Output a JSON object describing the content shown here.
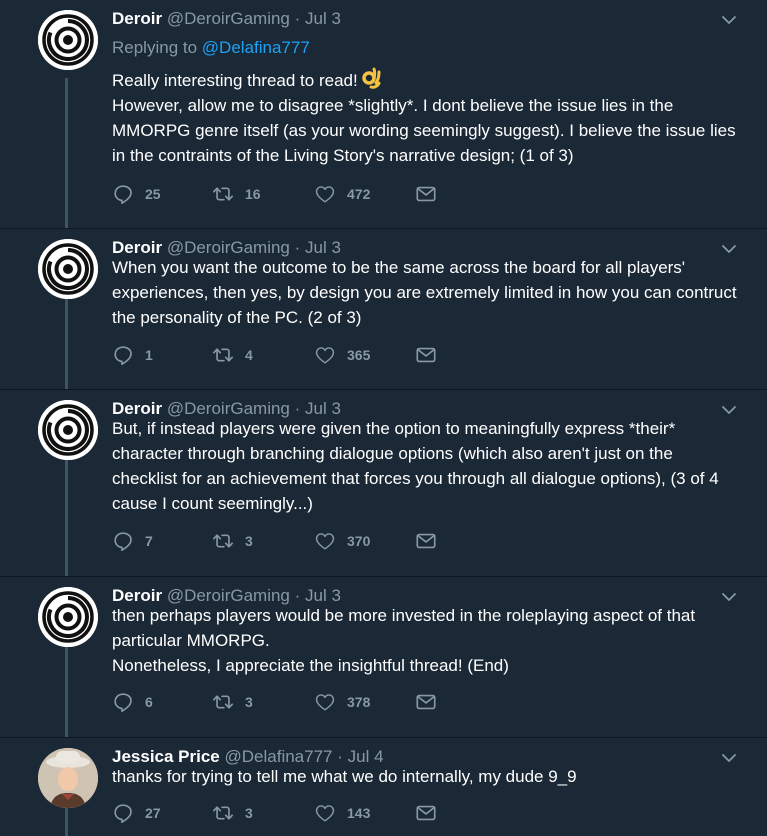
{
  "colors": {
    "background": "#1b2836",
    "text": "#ffffff",
    "muted": "#8899a6",
    "link": "#1da1f2",
    "thread_line": "#3d5466"
  },
  "tweets": [
    {
      "name": "Deroir",
      "handle": "@DeroirGaming",
      "dot": "·",
      "date": "Jul 3",
      "reply_prefix": "Replying to",
      "reply_mention": "@Delafina777",
      "lines": [
        "Really interesting thread to read!",
        "However, allow me to disagree *slightly*. I dont believe the issue lies in the MMORPG genre itself (as your wording seemingly suggest). I believe the issue lies in the contraints of the Living Story's narrative design; (1 of 3)"
      ],
      "emoji": "ok-hand-emoji",
      "replies": "25",
      "retweets": "16",
      "likes": "472"
    },
    {
      "name": "Deroir",
      "handle": "@DeroirGaming",
      "dot": "·",
      "date": "Jul 3",
      "lines": [
        "When you want the outcome to be the same across the board for all players' experiences, then yes, by design you are extremely limited in how you can contruct the personality of the PC. (2 of 3)"
      ],
      "replies": "1",
      "retweets": "4",
      "likes": "365"
    },
    {
      "name": "Deroir",
      "handle": "@DeroirGaming",
      "dot": "·",
      "date": "Jul 3",
      "lines": [
        "But, if instead players were given the option to meaningfully express *their* character through branching dialogue options (which also aren't just on the checklist for an achievement that forces you through all dialogue options), (3 of 4 cause I count seemingly...)"
      ],
      "replies": "7",
      "retweets": "3",
      "likes": "370"
    },
    {
      "name": "Deroir",
      "handle": "@DeroirGaming",
      "dot": "·",
      "date": "Jul 3",
      "lines": [
        "then perhaps players would be more invested in the roleplaying aspect of that particular MMORPG.",
        "Nonetheless, I appreciate the insightful thread! (End)"
      ],
      "replies": "6",
      "retweets": "3",
      "likes": "378"
    },
    {
      "name": "Jessica Price",
      "handle": "@Delafina777",
      "dot": "·",
      "date": "Jul 4",
      "lines": [
        "thanks for trying to tell me what we do internally, my dude 9_9"
      ],
      "replies": "27",
      "retweets": "3",
      "likes": "143"
    }
  ],
  "icons": [
    "reply-icon",
    "retweet-icon",
    "like-icon",
    "message-icon",
    "chevron-down-icon"
  ]
}
